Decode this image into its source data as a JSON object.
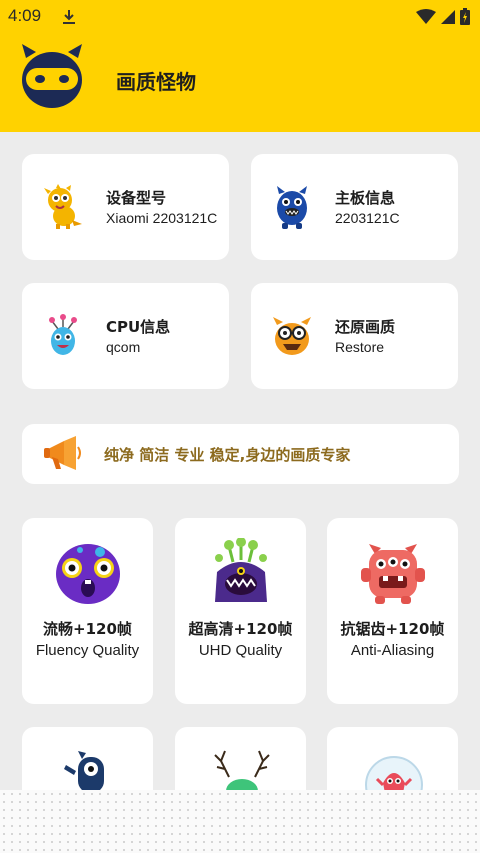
{
  "status_bar": {
    "time": "4:09",
    "icons": [
      "download-icon",
      "wifi-icon",
      "signal-icon",
      "battery-icon"
    ]
  },
  "app_bar": {
    "title": "画质怪物",
    "logo": "ninja-monster-logo",
    "background_color": "#ffd200"
  },
  "info_cards": [
    {
      "title": "设备型号",
      "value": "Xiaomi 2203121C",
      "icon": "yellow-monster-icon"
    },
    {
      "title": "主板信息",
      "value": "2203121C",
      "icon": "blue-monster-icon"
    },
    {
      "title": "CPU信息",
      "value": "qcom",
      "icon": "balloon-monster-icon"
    },
    {
      "title": "还原画质",
      "value": "Restore",
      "icon": "orange-glasses-monster-icon"
    }
  ],
  "banner": {
    "text": "纯净 简洁 专业 稳定,身边的画质专家",
    "icon": "megaphone-icon",
    "text_color": "#8c6a1e"
  },
  "mode_cards": [
    {
      "title": "流畅+120帧",
      "subtitle": "Fluency Quality",
      "icon": "purple-monster-icon"
    },
    {
      "title": "超高清+120帧",
      "subtitle": "UHD Quality",
      "icon": "antenna-monster-icon"
    },
    {
      "title": "抗锯齿+120帧",
      "subtitle": "Anti-Aliasing",
      "icon": "red-three-eyed-monster-icon"
    }
  ],
  "mode_cards_row2_icons": [
    "one-eyed-monster-icon",
    "antler-monster-icon",
    "bubble-monster-icon"
  ]
}
